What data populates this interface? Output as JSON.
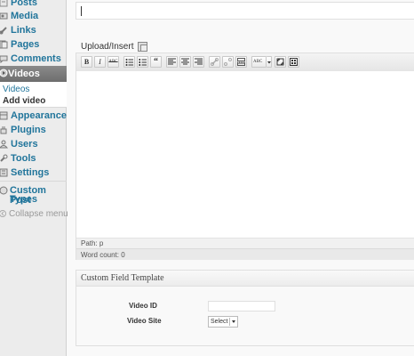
{
  "sidebar": {
    "items": [
      {
        "label": "Posts"
      },
      {
        "label": "Media"
      },
      {
        "label": "Links"
      },
      {
        "label": "Pages"
      },
      {
        "label": "Comments"
      },
      {
        "label": "Videos"
      },
      {
        "label": "Appearance"
      },
      {
        "label": "Plugins"
      },
      {
        "label": "Users"
      },
      {
        "label": "Tools"
      },
      {
        "label": "Settings"
      }
    ],
    "submenu": [
      {
        "label": "Videos"
      },
      {
        "label": "Add video"
      }
    ],
    "custom_post_types": {
      "line1": "Custom Post",
      "line2": "Types"
    },
    "collapse": "Collapse menu"
  },
  "editor": {
    "upload_label": "Upload/Insert",
    "path_label": "Path:",
    "path_value": "p",
    "word_count": "Word count: 0",
    "toolbar": {
      "bold": "B",
      "italic": "I",
      "strike": "ABC",
      "quote": "“",
      "spell": "ABC"
    }
  },
  "custom_fields": {
    "title": "Custom Field Template",
    "video_id_label": "Video ID",
    "video_id_value": "",
    "video_site_label": "Video Site",
    "video_site_selected": "Select"
  },
  "colors": {
    "link": "#21759b",
    "active_menu": "#7a7a7a"
  }
}
